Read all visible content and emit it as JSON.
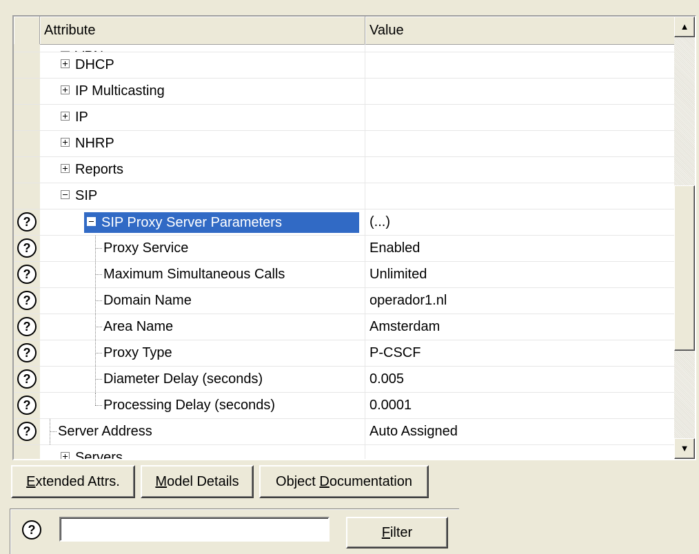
{
  "grid": {
    "header": {
      "attribute": "Attribute",
      "value": "Value"
    },
    "rows": [
      {
        "label": "VPN",
        "value": "",
        "indent": 0,
        "toggle": "minus",
        "help": false,
        "partial": true
      },
      {
        "label": "DHCP",
        "value": "",
        "indent": 0,
        "toggle": "plus",
        "help": false
      },
      {
        "label": "IP Multicasting",
        "value": "",
        "indent": 0,
        "toggle": "plus",
        "help": false
      },
      {
        "label": "IP",
        "value": "",
        "indent": 0,
        "toggle": "plus",
        "help": false
      },
      {
        "label": "NHRP",
        "value": "",
        "indent": 0,
        "toggle": "plus",
        "help": false
      },
      {
        "label": "Reports",
        "value": "",
        "indent": 0,
        "toggle": "plus",
        "help": false
      },
      {
        "label": "SIP",
        "value": "",
        "indent": 0,
        "toggle": "minus",
        "help": false
      },
      {
        "label": "SIP Proxy Server Parameters",
        "value": "(...)",
        "indent": 1,
        "toggle": "minus",
        "help": true,
        "selected": true
      },
      {
        "label": "Proxy Service",
        "value": "Enabled",
        "indent": 2,
        "help": true
      },
      {
        "label": "Maximum Simultaneous Calls",
        "value": "Unlimited",
        "indent": 2,
        "help": true
      },
      {
        "label": "Domain Name",
        "value": "operador1.nl",
        "indent": 2,
        "help": true
      },
      {
        "label": "Area Name",
        "value": "Amsterdam",
        "indent": 2,
        "help": true
      },
      {
        "label": "Proxy Type",
        "value": "P-CSCF",
        "indent": 2,
        "help": true
      },
      {
        "label": "Diameter Delay (seconds)",
        "value": "0.005",
        "indent": 2,
        "help": true
      },
      {
        "label": "Processing Delay (seconds)",
        "value": "0.0001",
        "indent": 2,
        "help": true,
        "last": true
      },
      {
        "label": "Server Address",
        "value": "Auto Assigned",
        "indent": 1,
        "help": true,
        "leaf": true
      },
      {
        "label": "Servers",
        "value": "",
        "indent": 0,
        "toggle": "plus",
        "help": false
      }
    ]
  },
  "icons": {
    "help": "?",
    "help_name": "help-icon",
    "scroll_up": "▲",
    "scroll_down": "▼"
  },
  "buttons": {
    "extended_attrs": {
      "pre": "",
      "u": "E",
      "post": "xtended Attrs."
    },
    "model_details": {
      "pre": "",
      "u": "M",
      "post": "odel Details"
    },
    "object_documentation": {
      "pre": "Object ",
      "u": "D",
      "post": "ocumentation"
    },
    "filter": {
      "pre": "",
      "u": "F",
      "post": "ilter"
    }
  },
  "filter": {
    "value": "",
    "placeholder": ""
  },
  "colors": {
    "selection": "#316ac5",
    "window_bg": "#ece9d8"
  }
}
